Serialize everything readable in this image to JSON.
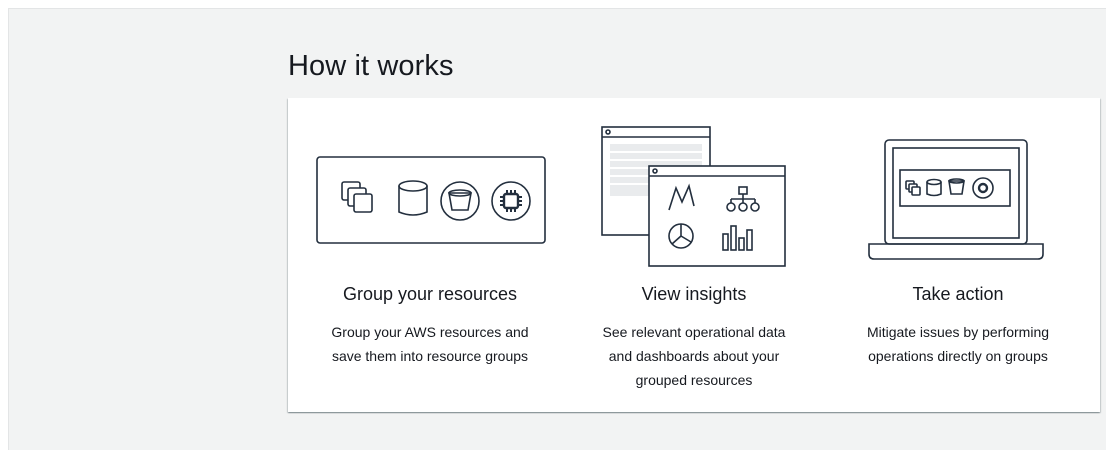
{
  "section": {
    "title": "How it works"
  },
  "steps": [
    {
      "title": "Group your resources",
      "description_lines": [
        "Group your AWS resources and",
        "save them into resource groups"
      ],
      "icon": "resource-group-illustration"
    },
    {
      "title": "View insights",
      "description_lines": [
        "See relevant operational data",
        "and dashboards about your",
        "grouped resources"
      ],
      "icon": "insights-dashboard-illustration"
    },
    {
      "title": "Take action",
      "description_lines": [
        "Mitigate issues by performing",
        "operations directly on groups"
      ],
      "icon": "laptop-action-illustration"
    }
  ],
  "colors": {
    "stroke": "#232f3e",
    "background": "#f2f3f3",
    "card": "#ffffff",
    "text": "#16191f"
  }
}
